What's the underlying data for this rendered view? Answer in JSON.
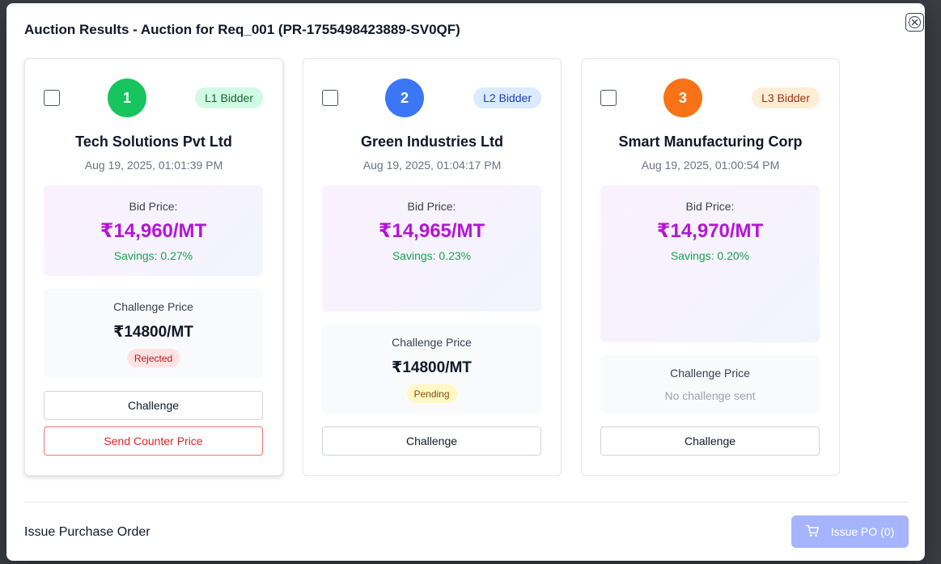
{
  "modal": {
    "title": "Auction Results - Auction for Req_001 (PR-1755498423889-SV0QF)",
    "close_icon": "close-circle-icon"
  },
  "bids": [
    {
      "rank": "1",
      "rank_color": "#16c55e",
      "badge": "L1 Bidder",
      "badge_bg": "#d1fae5",
      "badge_color": "#166534",
      "vendor": "Tech Solutions Pvt Ltd",
      "time": "Aug 19, 2025, 01:01:39 PM",
      "bid_label": "Bid Price:",
      "bid_price": "₹14,960/MT",
      "savings": "Savings: 0.27%",
      "challenge_label": "Challenge Price",
      "challenge_price": "₹14800/MT",
      "challenge_status": "Rejected",
      "status_bg": "#fee2e2",
      "status_color": "#b91c1c",
      "challenge_button": "Challenge",
      "counter_button": "Send Counter Price"
    },
    {
      "rank": "2",
      "rank_color": "#3b76f6",
      "badge": "L2 Bidder",
      "badge_bg": "#dbeafe",
      "badge_color": "#1e40af",
      "vendor": "Green Industries Ltd",
      "time": "Aug 19, 2025, 01:04:17 PM",
      "bid_label": "Bid Price:",
      "bid_price": "₹14,965/MT",
      "savings": "Savings: 0.23%",
      "challenge_label": "Challenge Price",
      "challenge_price": "₹14800/MT",
      "challenge_status": "Pending",
      "status_bg": "#fef9c3",
      "status_color": "#854d0e",
      "challenge_button": "Challenge"
    },
    {
      "rank": "3",
      "rank_color": "#f97316",
      "badge": "L3 Bidder",
      "badge_bg": "#ffedd5",
      "badge_color": "#9a3412",
      "vendor": "Smart Manufacturing Corp",
      "time": "Aug 19, 2025, 01:00:54 PM",
      "bid_label": "Bid Price:",
      "bid_price": "₹14,970/MT",
      "savings": "Savings: 0.20%",
      "challenge_label": "Challenge Price",
      "challenge_none": "No challenge sent",
      "challenge_button": "Challenge"
    }
  ],
  "footer": {
    "title": "Issue Purchase Order",
    "issue_button": "Issue PO (0)",
    "issue_icon": "shopping-cart-icon"
  }
}
